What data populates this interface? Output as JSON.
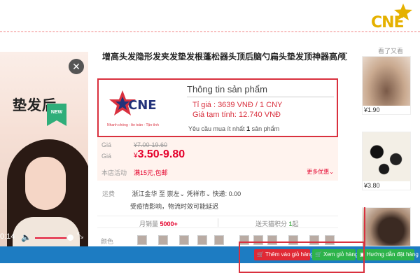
{
  "header": {
    "brand": "CNE",
    "accent": "#e5b100",
    "border": "#f08080"
  },
  "video": {
    "caption": "垫发后",
    "badge": "NEW",
    "close_symbol": "✕",
    "time": "0:14",
    "volume_symbol": "🔈",
    "fullscreen_symbol": "⤡",
    "progress": 0.9
  },
  "product": {
    "title": "增高头发隐形发夹发垫发根蓬松器头顶后脑勺扁头垫发顶神器高颅顶",
    "info": {
      "brand": "CNE",
      "tagline": "Nhanh chóng - An toàn - Tận tình",
      "heading": "Thông tin sản phẩm",
      "rate": "Tỉ giá : 3639 VNĐ / 1 CNY",
      "temp_price": "Giá tạm tính: 12.740 VNĐ",
      "min_order_prefix": "Yêu cầu mua ít nhất",
      "min_order_qty": "1",
      "min_order_suffix": "sản phẩm",
      "border_color": "#d9303e"
    },
    "price": {
      "label1": "Giá",
      "old": "¥7.00-19.60",
      "label2": "Giá",
      "currency": "¥",
      "new": "3.50-9.80",
      "promo_label": "本店活动",
      "promo": "满15元,包邮",
      "more": "更多优惠"
    },
    "shipping": {
      "label": "运费",
      "route": "浙江金华 至 崇左",
      "route_sub": "凭祥市",
      "fee": "快递: 0.00",
      "note": "受疫情影响，物流时效可能延迟"
    },
    "stats": {
      "monthly_label": "月销量",
      "monthly_value": "5000+",
      "points_label": "送天猫积分",
      "points_value": "1",
      "points_unit": "起"
    },
    "color_label": "颜色"
  },
  "sidebar": {
    "heading": "看了又看",
    "items": [
      {
        "price": "¥1.90"
      },
      {
        "price": "¥3.80"
      },
      {
        "price": ""
      }
    ]
  },
  "actions": {
    "add_cart": {
      "icon": "cart-icon",
      "label": "Thêm vào giỏ hàng"
    },
    "view_cart": {
      "icon": "cart-icon",
      "label": "Xem giỏ hàng"
    },
    "guide": {
      "icon": "guide-icon",
      "label": "Hướng dẫn đặt hàng"
    },
    "bar_color": "#1d7cc2",
    "red": "#e02935",
    "green": "#2db34a"
  }
}
